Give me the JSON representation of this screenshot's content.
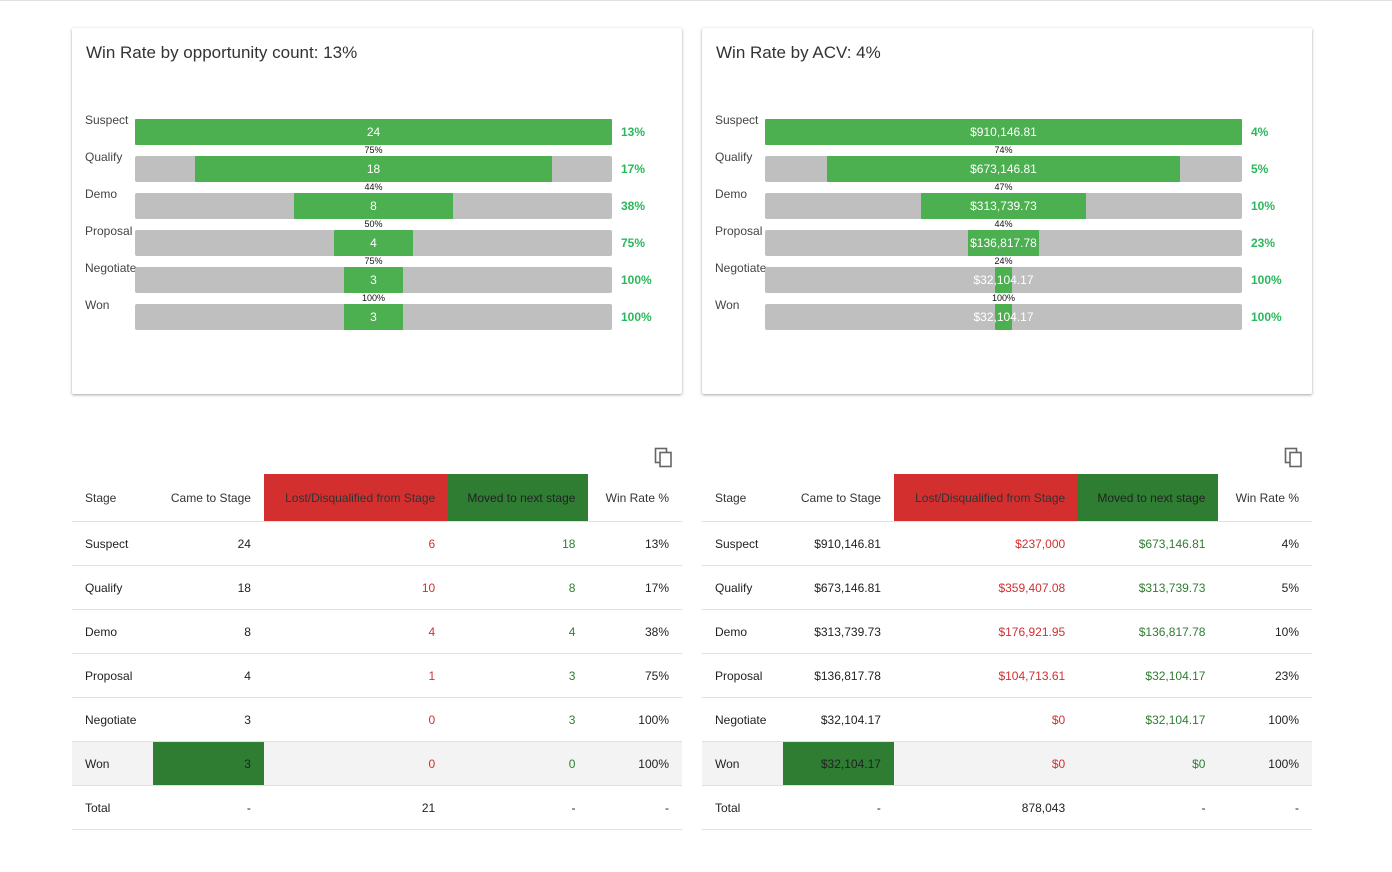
{
  "chart_data": [
    {
      "type": "bar",
      "title": "Win Rate by opportunity count: 13%",
      "categories": [
        "Suspect",
        "Qualify",
        "Demo",
        "Proposal",
        "Negotiate",
        "Won"
      ],
      "values": [
        24,
        18,
        8,
        4,
        3,
        3
      ],
      "value_labels": [
        "24",
        "18",
        "8",
        "4",
        "3",
        "3"
      ],
      "win_rates": [
        "13%",
        "17%",
        "38%",
        "75%",
        "100%",
        "100%"
      ],
      "conversion_labels": [
        "75%",
        "44%",
        "50%",
        "75%",
        "100%"
      ],
      "max": 24
    },
    {
      "type": "bar",
      "title": "Win Rate by ACV: 4%",
      "categories": [
        "Suspect",
        "Qualify",
        "Demo",
        "Proposal",
        "Negotiate",
        "Won"
      ],
      "values": [
        910146.81,
        673146.81,
        313739.73,
        136817.78,
        32104.17,
        32104.17
      ],
      "value_labels": [
        "$910,146.81",
        "$673,146.81",
        "$313,739.73",
        "$136,817.78",
        "$32,104.17",
        "$32,104.17"
      ],
      "win_rates": [
        "4%",
        "5%",
        "10%",
        "23%",
        "100%",
        "100%"
      ],
      "conversion_labels": [
        "74%",
        "47%",
        "44%",
        "24%",
        "100%"
      ],
      "max": 910146.81
    }
  ],
  "tables": [
    {
      "headers": [
        "Stage",
        "Came to Stage",
        "Lost/Disqualified from Stage",
        "Moved to next stage",
        "Win Rate %"
      ],
      "rows": [
        [
          "Suspect",
          "24",
          "6",
          "18",
          "13%"
        ],
        [
          "Qualify",
          "18",
          "10",
          "8",
          "17%"
        ],
        [
          "Demo",
          "8",
          "4",
          "4",
          "38%"
        ],
        [
          "Proposal",
          "4",
          "1",
          "3",
          "75%"
        ],
        [
          "Negotiate",
          "3",
          "0",
          "3",
          "100%"
        ],
        [
          "Won",
          "3",
          "0",
          "0",
          "100%"
        ]
      ],
      "total": [
        "Total",
        "-",
        "21",
        "-",
        "-"
      ]
    },
    {
      "headers": [
        "Stage",
        "Came to Stage",
        "Lost/Disqualified from Stage",
        "Moved to next stage",
        "Win Rate %"
      ],
      "rows": [
        [
          "Suspect",
          "$910,146.81",
          "$237,000",
          "$673,146.81",
          "4%"
        ],
        [
          "Qualify",
          "$673,146.81",
          "$359,407.08",
          "$313,739.73",
          "5%"
        ],
        [
          "Demo",
          "$313,739.73",
          "$176,921.95",
          "$136,817.78",
          "10%"
        ],
        [
          "Proposal",
          "$136,817.78",
          "$104,713.61",
          "$32,104.17",
          "23%"
        ],
        [
          "Negotiate",
          "$32,104.17",
          "$0",
          "$32,104.17",
          "100%"
        ],
        [
          "Won",
          "$32,104.17",
          "$0",
          "$0",
          "100%"
        ]
      ],
      "total": [
        "Total",
        "-",
        "878,043",
        "-",
        "-"
      ]
    }
  ],
  "icons": {
    "copy": "copy-icon"
  },
  "colors": {
    "bar_fill": "#4caf50",
    "bar_track": "#bfbfbf",
    "rate_text": "#2bb85c",
    "lost_header": "#d32f2f",
    "moved_header": "#2e7d32"
  }
}
